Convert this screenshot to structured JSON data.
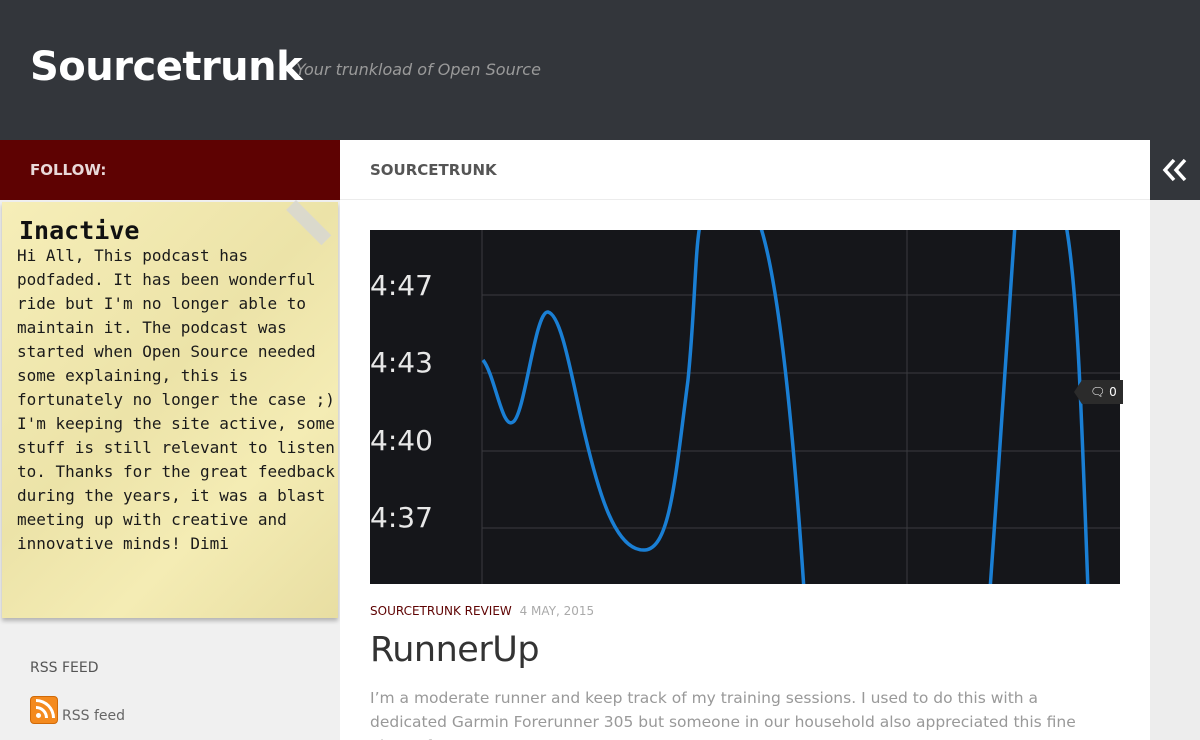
{
  "header": {
    "site_title": "Sourcetrunk",
    "tagline": "Your trunkload of Open Source"
  },
  "sidebar": {
    "follow_label": "FOLLOW:",
    "note": {
      "title": "Inactive",
      "body": "Hi All, This podcast has podfaded. It has been wonderful ride but I'm no longer able to maintain it. The podcast was started when Open Source needed some explaining, this is fortunately no longer the case ;) I'm keeping the site active, some stuff is still relevant to listen to. Thanks for the great feedback during the years, it was a blast meeting up with creative and innovative minds! Dimi"
    },
    "rss": {
      "heading": "RSS FEED",
      "link_label": "RSS feed",
      "icon": "rss-icon"
    }
  },
  "main": {
    "heading": "SOURCETRUNK",
    "post": {
      "category": "SOURCETRUNK REVIEW",
      "date": "4 MAY, 2015",
      "title": "RunnerUp",
      "excerpt": "I’m a moderate runner and keep track of my training sessions. I used to do this with a dedicated Garmin Forerunner 305 but someone in our household also appreciated this fine piece of",
      "comment_count": "0",
      "thumbnail": {
        "y_labels": [
          "4:47",
          "4:43",
          "4:40",
          "4:37"
        ],
        "line_color": "#1a7fd4",
        "background": "#15161a"
      }
    }
  },
  "colors": {
    "header_bg": "#33363b",
    "follow_bg": "#5e0202",
    "accent": "#5e0202"
  }
}
